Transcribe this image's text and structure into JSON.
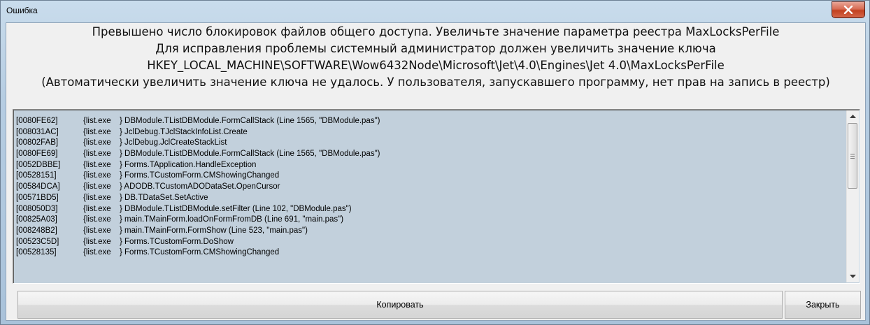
{
  "window": {
    "title": "Ошибка",
    "close_glyph": "X"
  },
  "message": {
    "lines": [
      "Превышено число блокировок файлов общего доступа. Увеличьте значение параметра реестра MaxLocksPerFile",
      "Для исправления проблемы системный администратор должен увеличить значение ключа",
      "HKEY_LOCAL_MACHINE\\SOFTWARE\\Wow6432Node\\Microsoft\\Jet\\4.0\\Engines\\Jet 4.0\\MaxLocksPerFile",
      "(Автоматически увеличить значение ключа не удалось. У пользователя, запускавшего программу, нет прав на запись в реестр)"
    ]
  },
  "stack": {
    "lines": [
      {
        "addr": "[0080FE62]",
        "exe": "{list.exe",
        "text": "} DBModule.TListDBModule.FormCallStack (Line 1565, \"DBModule.pas\")"
      },
      {
        "addr": "[008031AC]",
        "exe": "{list.exe",
        "text": "} JclDebug.TJclStackInfoList.Create"
      },
      {
        "addr": "[00802FAB]",
        "exe": "{list.exe",
        "text": "} JclDebug.JclCreateStackList"
      },
      {
        "addr": "[0080FE69]",
        "exe": "{list.exe",
        "text": "} DBModule.TListDBModule.FormCallStack (Line 1565, \"DBModule.pas\")"
      },
      {
        "addr": "[0052DBBE]",
        "exe": "{list.exe",
        "text": "} Forms.TApplication.HandleException"
      },
      {
        "addr": "[00528151]",
        "exe": "{list.exe",
        "text": "} Forms.TCustomForm.CMShowingChanged"
      },
      {
        "addr": "[00584DCA]",
        "exe": "{list.exe",
        "text": "} ADODB.TCustomADODataSet.OpenCursor"
      },
      {
        "addr": "[00571BD5]",
        "exe": "{list.exe",
        "text": "} DB.TDataSet.SetActive"
      },
      {
        "addr": "[008050D3]",
        "exe": "{list.exe",
        "text": "} DBModule.TListDBModule.setFilter (Line 102, \"DBModule.pas\")"
      },
      {
        "addr": "[00825A03]",
        "exe": "{list.exe",
        "text": "} main.TMainForm.loadOnFormFromDB (Line 691, \"main.pas\")"
      },
      {
        "addr": "[008248B2]",
        "exe": "{list.exe",
        "text": "} main.TMainForm.FormShow (Line 523, \"main.pas\")"
      },
      {
        "addr": "[00523C5D]",
        "exe": "{list.exe",
        "text": "} Forms.TCustomForm.DoShow"
      },
      {
        "addr": "[00528135]",
        "exe": "{list.exe",
        "text": "} Forms.TCustomForm.CMShowingChanged"
      }
    ]
  },
  "buttons": {
    "copy_label": "Копировать",
    "close_label": "Закрыть"
  },
  "colors": {
    "memo_background": "#c2d0dc",
    "close_button": "#c1401f"
  },
  "icons": {
    "close": "close-icon",
    "scroll_up": "arrow-up-icon",
    "scroll_down": "arrow-down-icon",
    "scroll_thumb_grip": "grip-icon"
  }
}
